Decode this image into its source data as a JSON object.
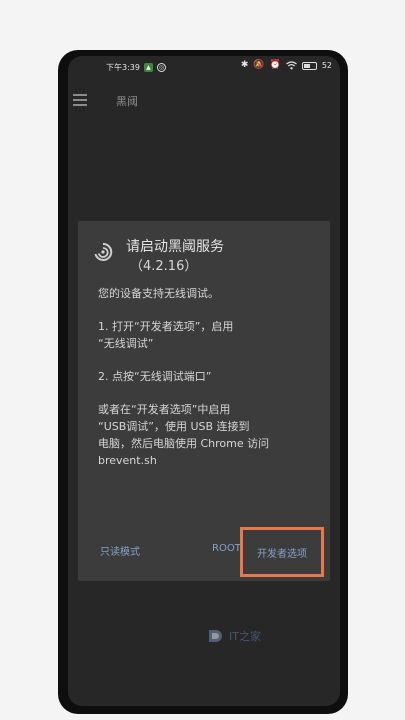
{
  "statusbar": {
    "time": "下午3:39",
    "battery_text": "52",
    "battery_level": 0.52,
    "icons": [
      "bluetooth-icon",
      "mute-icon",
      "alarm-icon",
      "wifi-icon",
      "battery-icon"
    ]
  },
  "appbar": {
    "title": "黑阈"
  },
  "dialog": {
    "title": "请启动黑阈服务",
    "version": "（4.2.16）",
    "line_intro": "您的设备支持无线调试。",
    "step1": "1. 打开“开发者选项”，启用\n“无线调试”",
    "step2": "2. 点按“无线调试端口”",
    "alt": "或者在“开发者选项”中启用\n“USB调试”，使用 USB 连接到\n电脑，然后电脑使用 Chrome 访问\nbrevent.sh",
    "buttons": {
      "readonly": "只读模式",
      "root": "ROOT",
      "developer": "开发者选项"
    }
  },
  "watermark": {
    "text": "IT之家"
  },
  "colors": {
    "highlight": "#e8774a",
    "button_text": "#8a9fc8",
    "dialog_bg": "#3c3c3c",
    "screen_bg": "#272727"
  }
}
